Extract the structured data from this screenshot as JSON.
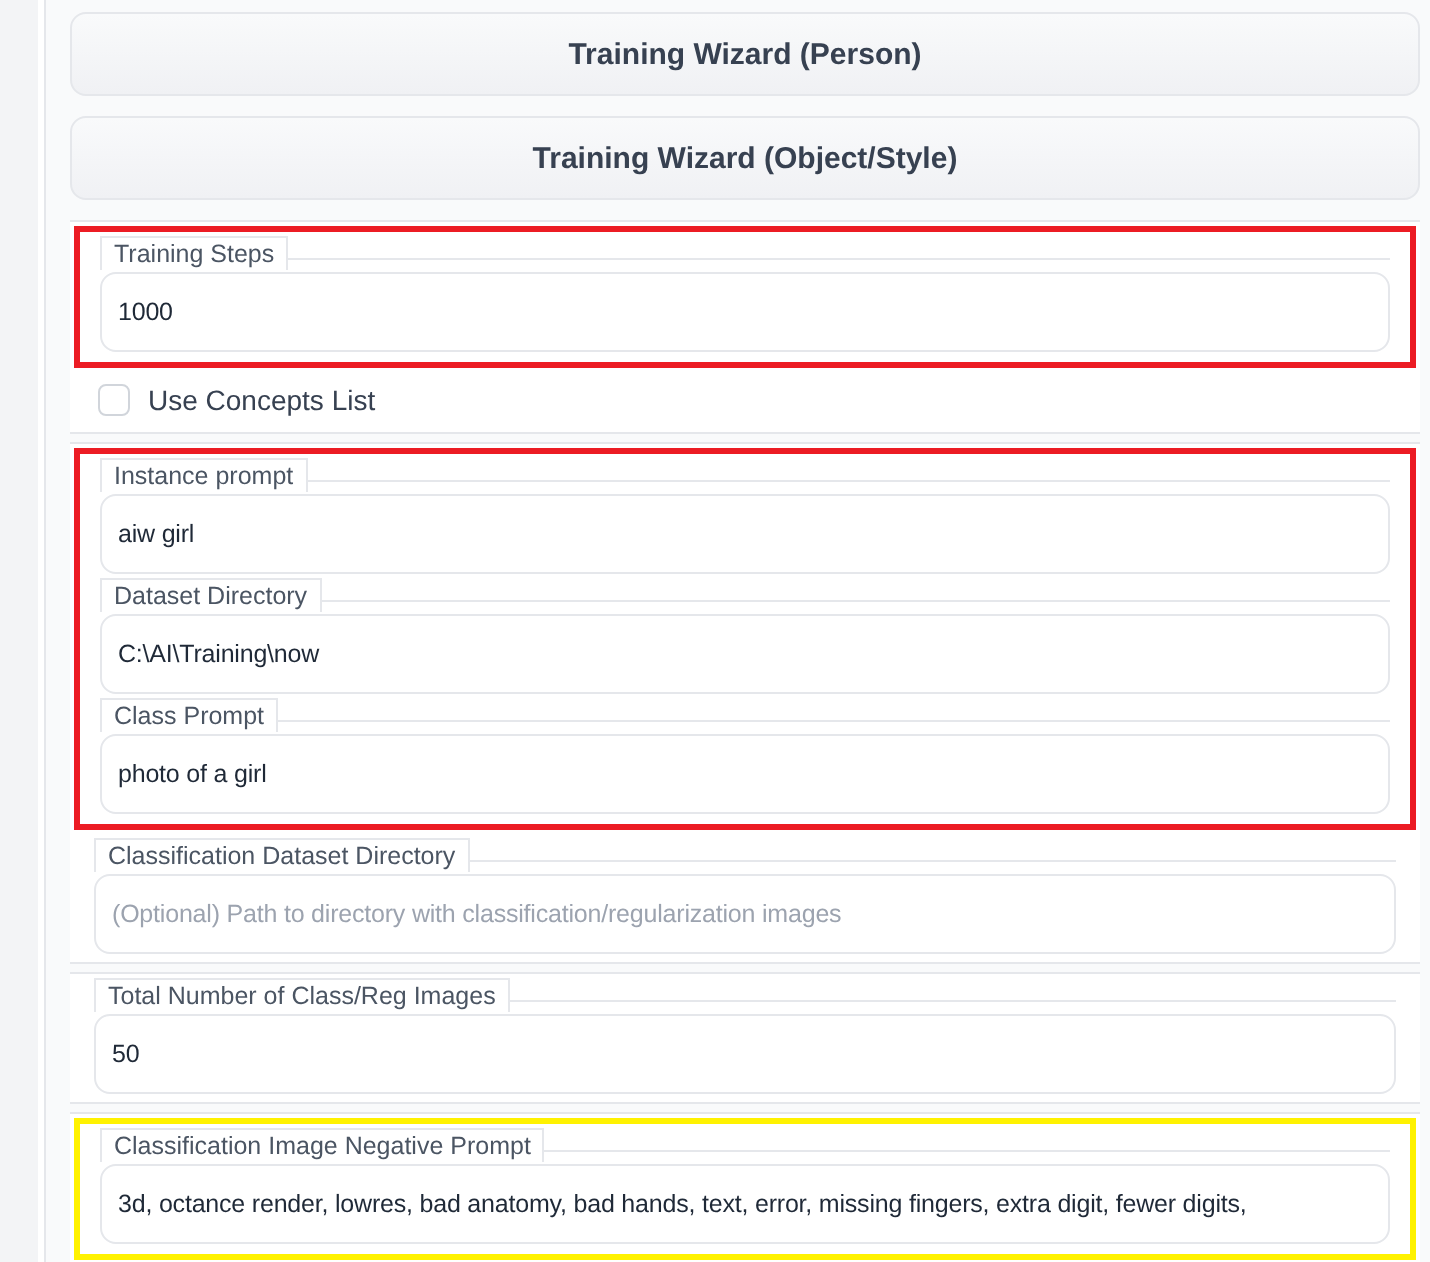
{
  "wizard_buttons": [
    {
      "label": "Training Wizard (Person)"
    },
    {
      "label": "Training Wizard (Object/Style)"
    }
  ],
  "sections": [
    {
      "items": [
        {
          "kind": "highlight",
          "color": "#ec1c24",
          "fields": [
            {
              "label": "Training Steps",
              "value": "1000"
            }
          ]
        },
        {
          "kind": "checkbox",
          "label": "Use Concepts List",
          "checked": false
        }
      ]
    },
    {
      "items": [
        {
          "kind": "highlight",
          "color": "#ec1c24",
          "fields": [
            {
              "label": "Instance prompt",
              "value": "aiw girl"
            },
            {
              "label": "Dataset Directory",
              "value": "C:\\AI\\Training\\now"
            },
            {
              "label": "Class Prompt",
              "value": "photo of a girl"
            }
          ]
        },
        {
          "kind": "field",
          "label": "Classification Dataset Directory",
          "placeholder": "(Optional) Path to directory with classification/regularization images"
        }
      ]
    },
    {
      "items": [
        {
          "kind": "field",
          "label": "Total Number of Class/Reg Images",
          "value": "50"
        }
      ]
    },
    {
      "items": [
        {
          "kind": "highlight",
          "color": "#fff200",
          "fields": [
            {
              "label": "Classification Image Negative Prompt",
              "value": "3d, octance render, lowres, bad anatomy, bad hands, text, error, missing fingers, extra digit, fewer digits,"
            }
          ]
        }
      ]
    }
  ]
}
